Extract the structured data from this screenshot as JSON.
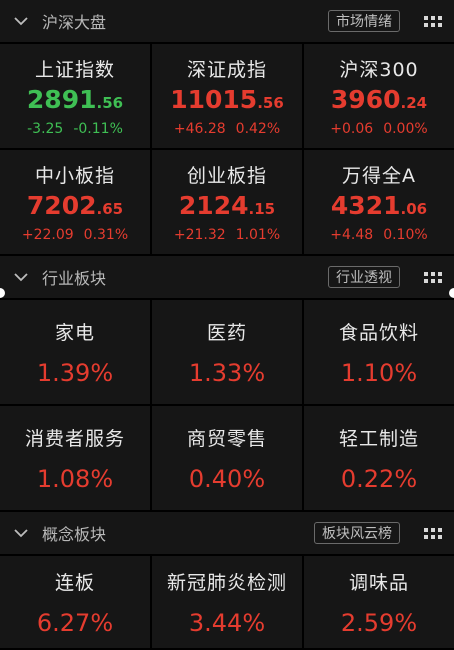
{
  "market": {
    "title": "沪深大盘",
    "tag": "市场情绪",
    "cells": [
      {
        "name": "上证指数",
        "int": "2891",
        "dec": ".56",
        "chg": "-3.25",
        "pct": "-0.11%",
        "dir": "down"
      },
      {
        "name": "深证成指",
        "int": "11015",
        "dec": ".56",
        "chg": "+46.28",
        "pct": "0.42%",
        "dir": "up"
      },
      {
        "name": "沪深300",
        "int": "3960",
        "dec": ".24",
        "chg": "+0.06",
        "pct": "0.00%",
        "dir": "up"
      },
      {
        "name": "中小板指",
        "int": "7202",
        "dec": ".65",
        "chg": "+22.09",
        "pct": "0.31%",
        "dir": "up"
      },
      {
        "name": "创业板指",
        "int": "2124",
        "dec": ".15",
        "chg": "+21.32",
        "pct": "1.01%",
        "dir": "up"
      },
      {
        "name": "万得全A",
        "int": "4321",
        "dec": ".06",
        "chg": "+4.48",
        "pct": "0.10%",
        "dir": "up"
      }
    ]
  },
  "industry": {
    "title": "行业板块",
    "tag": "行业透视",
    "cells": [
      {
        "name": "家电",
        "pct": "1.39%"
      },
      {
        "name": "医药",
        "pct": "1.33%"
      },
      {
        "name": "食品饮料",
        "pct": "1.10%"
      },
      {
        "name": "消费者服务",
        "pct": "1.08%"
      },
      {
        "name": "商贸零售",
        "pct": "0.40%"
      },
      {
        "name": "轻工制造",
        "pct": "0.22%"
      }
    ]
  },
  "concept": {
    "title": "概念板块",
    "tag": "板块风云榜",
    "cells": [
      {
        "name": "连板",
        "pct": "6.27%"
      },
      {
        "name": "新冠肺炎检测",
        "pct": "3.44%"
      },
      {
        "name": "调味品",
        "pct": "2.59%"
      }
    ]
  },
  "colors": {
    "up": "#e53c2f",
    "down": "#3fbf54",
    "panel": "#161616"
  },
  "icons": {
    "collapse": "chevron-down-icon",
    "menu": "grid-menu-icon"
  }
}
